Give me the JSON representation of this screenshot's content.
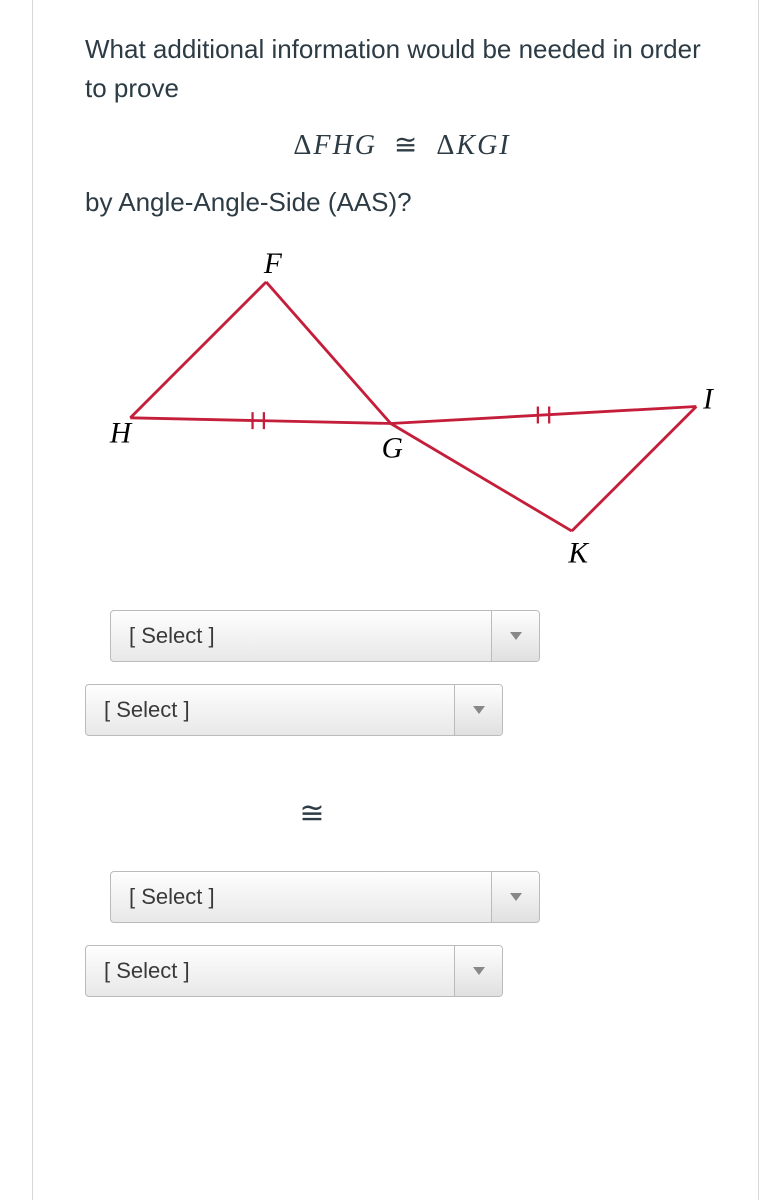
{
  "question": {
    "line1": "What additional information would be needed in order to prove",
    "expression": {
      "delta1": "Δ",
      "tri1": "FHG",
      "cong": "≅",
      "delta2": "Δ",
      "tri2": "KGI"
    },
    "line2": "by Angle-Angle-Side (AAS)?"
  },
  "diagram": {
    "labels": {
      "F": "F",
      "H": "H",
      "G": "G",
      "I": "I",
      "K": "K"
    }
  },
  "selects": {
    "placeholder": "[ Select ]"
  },
  "middleSymbol": "≅"
}
